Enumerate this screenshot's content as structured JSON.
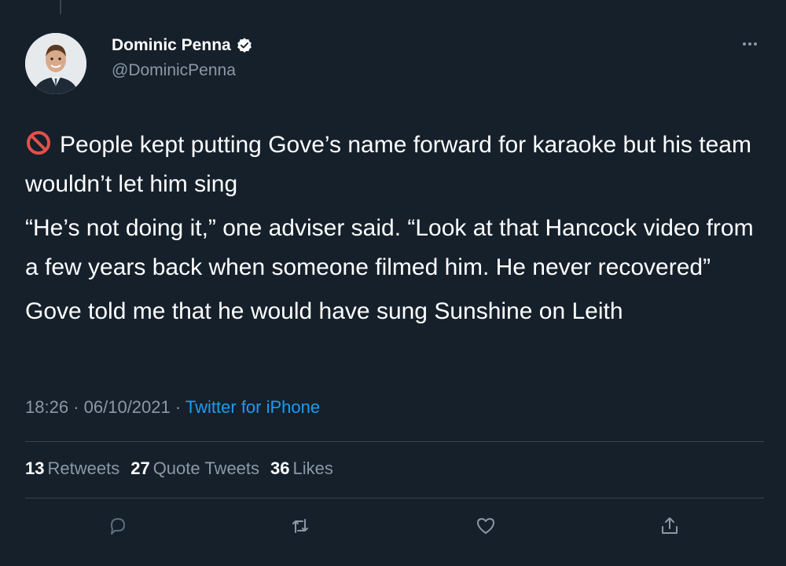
{
  "author": {
    "name": "Dominic Penna",
    "handle": "@DominicPenna"
  },
  "tweet": {
    "paragraphs": [
      "People kept putting Gove’s name forward for karaoke but his team wouldn’t let him sing",
      "“He’s not doing it,” one adviser said. “Look at that Hancock video from a few years back when someone filmed him. He never recovered”",
      "Gove told me that he would have sung Sunshine on Leith"
    ],
    "leading_emoji": "no-entry-sign-icon"
  },
  "meta": {
    "time": "18:26",
    "date": "06/10/2021",
    "separator": "·",
    "source": "Twitter for iPhone"
  },
  "stats": {
    "retweets_count": "13",
    "retweets_label": "Retweets",
    "quotes_count": "27",
    "quotes_label": "Quote Tweets",
    "likes_count": "36",
    "likes_label": "Likes"
  },
  "icons": {
    "reply": "reply-icon",
    "retweet": "retweet-icon",
    "like": "heart-icon",
    "share": "share-icon",
    "verified": "verified-badge-icon",
    "more": "more-icon"
  },
  "colors": {
    "background": "#15202b",
    "text": "#ffffff",
    "muted": "#8b98a5",
    "accent": "#1d9bf0",
    "divider": "#38444d"
  }
}
